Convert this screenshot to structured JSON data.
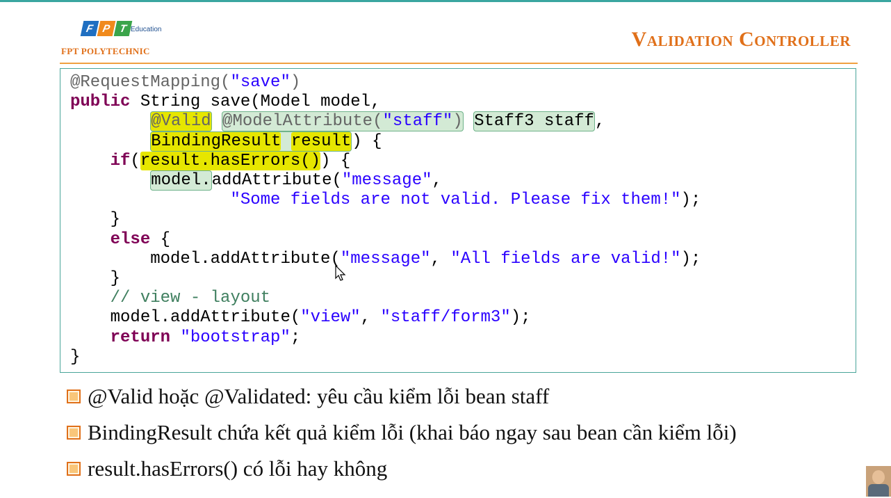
{
  "header": {
    "logo_letters": [
      "F",
      "P",
      "T"
    ],
    "logo_education": "Education",
    "logo_school": "FPT POLYTECHNIC",
    "title": "Validation Controller"
  },
  "code_lines": [
    "@RequestMapping(\"save\")",
    "public String save(Model model,",
    "@Valid @ModelAttribute(\"staff\") Staff3 staff,",
    "BindingResult result) {",
    "if(result.hasErrors()) {",
    "model.addAttribute(\"message\",",
    "\"Some fields are not valid. Please fix them!\");",
    "}",
    "else {",
    "model.addAttribute(\"message\", \"All fields are valid!\");",
    "}",
    "// view - layout",
    "model.addAttribute(\"view\", \"staff/form3\");",
    "return \"bootstrap\";",
    "}"
  ],
  "code": {
    "l1_ann": "@RequestMapping(",
    "l1_str": "\"save\"",
    "l1_end": ")",
    "l2_kw": "public",
    "l2_rest": " String save(Model model,",
    "l3_valid": "@Valid",
    "l3_ma": "@ModelAttribute(",
    "l3_str": "\"staff\"",
    "l3_close": ")",
    "l3_type": "Staff3 staff",
    "l3_comma": ",",
    "l4_br": "BindingResult",
    "l4_sp": " ",
    "l4_res": "result",
    "l4_end": ") {",
    "l5_kw": "if",
    "l5_open": "(",
    "l5_call": "result.hasErrors()",
    "l5_end": ") {",
    "l6_model": "model.",
    "l6_rest": "addAttribute(",
    "l6_str": "\"message\"",
    "l6_comma": ",",
    "l7_str": "\"Some fields are not valid. Please fix them!\"",
    "l7_end": ");",
    "l8": "}",
    "l9_kw": "else",
    "l9_end": " {",
    "l10_a": "model.addAttribute(",
    "l10_s1": "\"message\"",
    "l10_mid": ", ",
    "l10_s2": "\"All fields are valid!\"",
    "l10_end": ");",
    "l11": "}",
    "l12_cmt": "// view - layout",
    "l13_a": "model.addAttribute(",
    "l13_s1": "\"view\"",
    "l13_mid": ", ",
    "l13_s2": "\"staff/form3\"",
    "l13_end": ");",
    "l14_kw": "return",
    "l14_sp": " ",
    "l14_str": "\"bootstrap\"",
    "l14_end": ";",
    "l15": "}"
  },
  "bullets": [
    "@Valid hoặc @Validated: yêu cầu kiểm lỗi bean staff",
    "BindingResult chứa kết quả kiểm lỗi (khai báo ngay sau bean cần kiểm lỗi)",
    "result.hasErrors() có lỗi hay không"
  ],
  "colors": {
    "accent": "#e0701a",
    "frame": "#49a59a",
    "keyword": "#7f0055",
    "string": "#2a00ff",
    "highlight_yellow": "#e6e600",
    "highlight_green": "#d3ead5"
  },
  "icons": [
    "checkbox-bullet-icon",
    "mouse-cursor-icon",
    "presenter-avatar"
  ]
}
